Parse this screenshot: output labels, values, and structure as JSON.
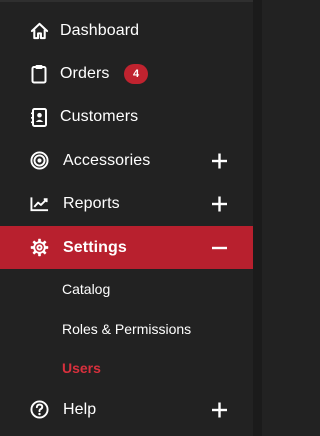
{
  "sidebar": {
    "items": [
      {
        "label": "Dashboard",
        "icon": "home-icon"
      },
      {
        "label": "Orders",
        "icon": "clipboard-icon",
        "badge": "4"
      },
      {
        "label": "Customers",
        "icon": "contact-book-icon"
      },
      {
        "label": "Accessories",
        "icon": "target-icon",
        "expand": "plus"
      },
      {
        "label": "Reports",
        "icon": "line-chart-icon",
        "expand": "plus"
      },
      {
        "label": "Settings",
        "icon": "gear-icon",
        "expand": "minus",
        "active": true
      },
      {
        "label": "Help",
        "icon": "question-circle-icon",
        "expand": "plus"
      }
    ],
    "settings_sub": [
      {
        "label": "Catalog"
      },
      {
        "label": "Roles & Permissions"
      },
      {
        "label": "Users",
        "current": true
      }
    ]
  },
  "colors": {
    "background": "#222222",
    "active_bg": "#b8202e",
    "badge_bg": "#c0232f",
    "current_sub_text": "#d8303d",
    "text": "#ffffff"
  }
}
